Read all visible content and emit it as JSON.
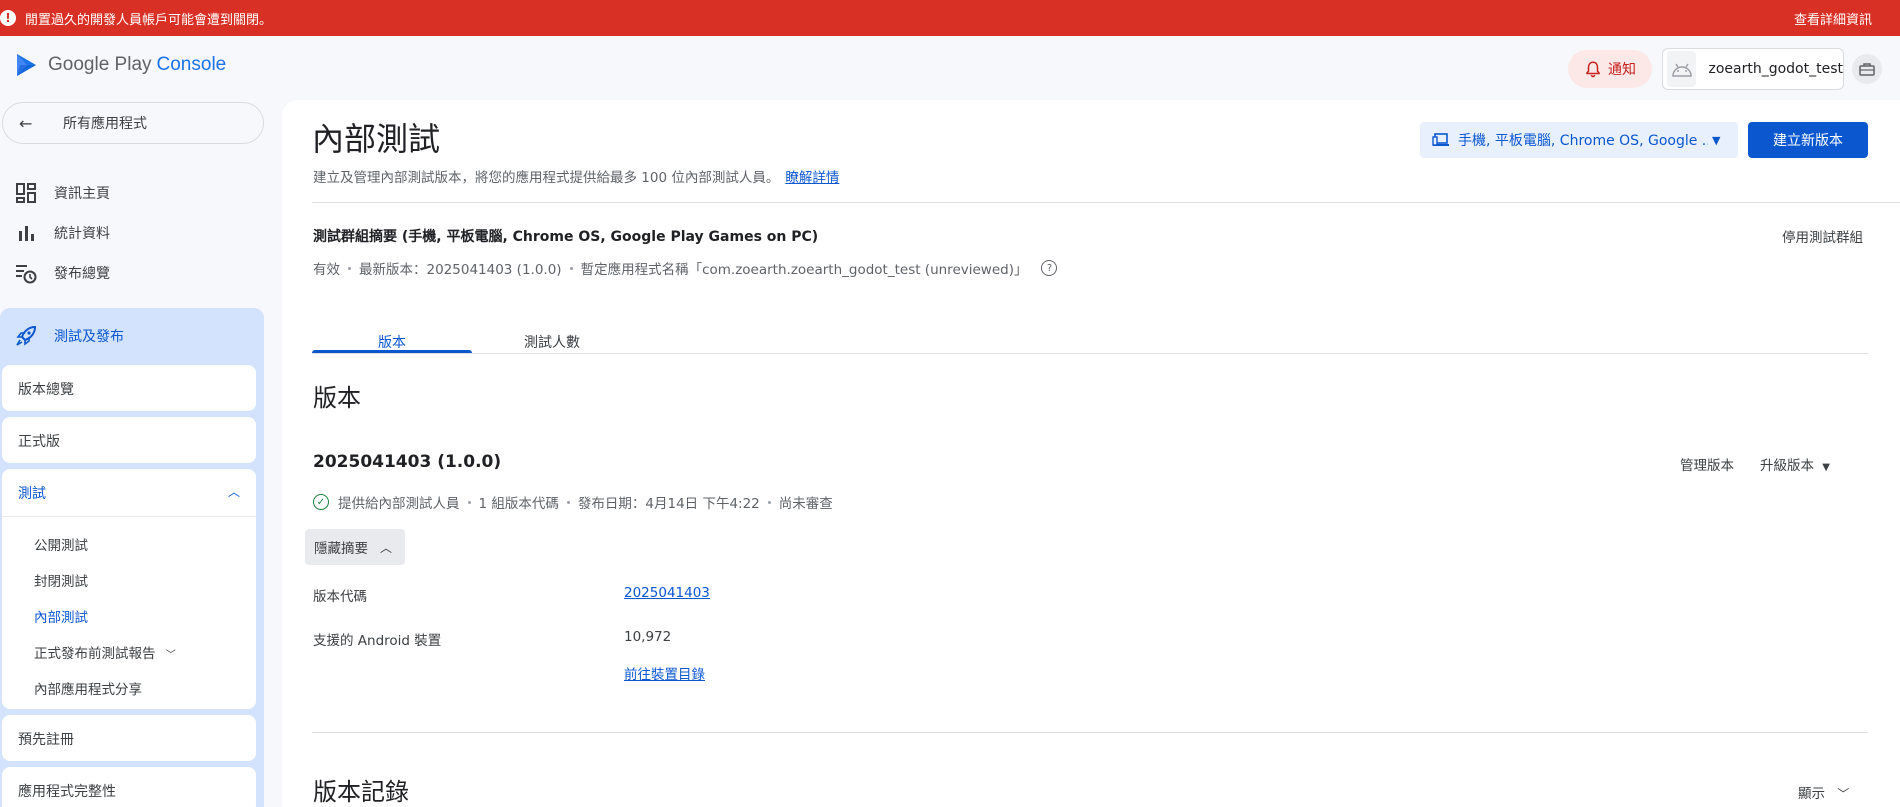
{
  "banner": {
    "message": "閒置過久的開發人員帳戶可能會遭到關閉。",
    "details_link": "查看詳細資訊",
    "color": "#d93025"
  },
  "header": {
    "brand_google_play": "Google Play",
    "brand_console": "Console",
    "notifications_label": "通知",
    "account_name": "zoearth_godot_test"
  },
  "sidebar": {
    "back_label": "所有應用程式",
    "items": [
      {
        "label": "資訊主頁",
        "icon": "dashboard-icon"
      },
      {
        "label": "統計資料",
        "icon": "bar-chart-icon"
      },
      {
        "label": "發布總覽",
        "icon": "publishing-overview-icon"
      }
    ],
    "section": {
      "label": "測試及發布",
      "icon": "rocket-icon",
      "release_overview": "版本總覽",
      "production": "正式版",
      "testing": "測試",
      "testing_items": [
        "公開測試",
        "封閉測試",
        "內部測試",
        "正式發布前測試報告",
        "內部應用程式分享"
      ],
      "pre_registration": "預先註冊",
      "app_integrity": "應用程式完整性"
    }
  },
  "main": {
    "title": "內部測試",
    "subtitle": "建立及管理內部測試版本，將您的應用程式提供給最多 100 位內部測試人員。",
    "learn_more": "瞭解詳情",
    "device_selector": "手機, 平板電腦, Chrome OS, Google ...",
    "create_release": "建立新版本",
    "group_summary_title": "測試群組摘要 (手機, 平板電腦, Chrome OS, Google Play Games on PC)",
    "disable_group": "停用測試群組",
    "meta": {
      "status": "有效",
      "latest_version": "最新版本：2025041403 (1.0.0)",
      "temp_name": "暫定應用程式名稱「com.zoearth.zoearth_godot_test (unreviewed)」"
    },
    "tabs": [
      "版本",
      "測試人數"
    ],
    "releases_section_title": "版本",
    "release": {
      "title": "2025041403 (1.0.0)",
      "manage": "管理版本",
      "upgrade": "升級版本",
      "available_to": "提供給內部測試人員",
      "codes": "1 組版本代碼",
      "published": "發布日期：4月14日 下午4:22",
      "review": "尚未審查",
      "hide_summary": "隱藏摘要",
      "version_code_label": "版本代碼",
      "version_code_value": "2025041403",
      "supported_devices_label": "支援的 Android 裝置",
      "supported_devices_value": "10,972",
      "device_catalog_link": "前往裝置目錄"
    },
    "history_title": "版本記錄",
    "history_show": "顯示"
  },
  "colors": {
    "primary": "#0b57d0",
    "success": "#188038",
    "sidebar_section_bg": "#d3e3fd"
  }
}
